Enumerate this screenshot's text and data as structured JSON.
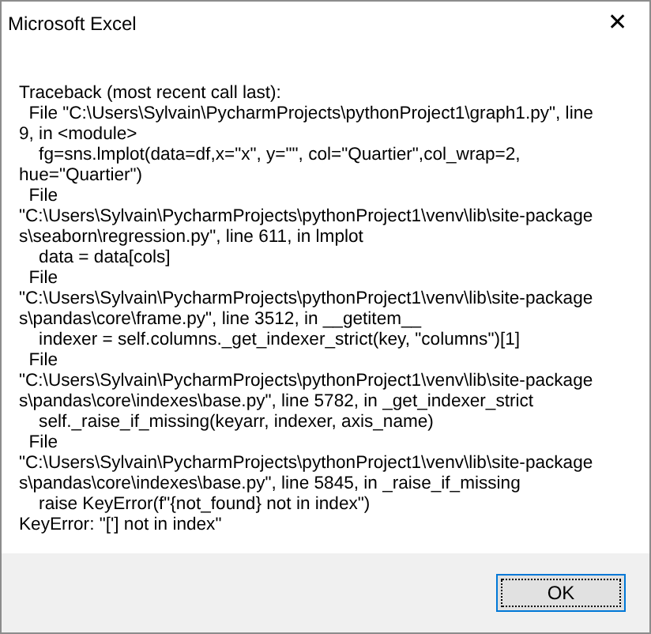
{
  "window": {
    "title": "Microsoft Excel",
    "close": "✕"
  },
  "message_lines": [
    "Traceback (most recent call last):",
    "  File \"C:\\Users\\Sylvain\\PycharmProjects\\pythonProject1\\graph1.py\", line",
    "9, in <module>",
    "    fg=sns.lmplot(data=df,x=\"x\", y=\"\", col=\"Quartier\",col_wrap=2,",
    "hue=\"Quartier\")",
    "  File",
    "\"C:\\Users\\Sylvain\\PycharmProjects\\pythonProject1\\venv\\lib\\site-package",
    "s\\seaborn\\regression.py\", line 611, in lmplot",
    "    data = data[cols]",
    "  File",
    "\"C:\\Users\\Sylvain\\PycharmProjects\\pythonProject1\\venv\\lib\\site-package",
    "s\\pandas\\core\\frame.py\", line 3512, in __getitem__",
    "    indexer = self.columns._get_indexer_strict(key, \"columns\")[1]",
    "  File",
    "\"C:\\Users\\Sylvain\\PycharmProjects\\pythonProject1\\venv\\lib\\site-package",
    "s\\pandas\\core\\indexes\\base.py\", line 5782, in _get_indexer_strict",
    "    self._raise_if_missing(keyarr, indexer, axis_name)",
    "  File",
    "\"C:\\Users\\Sylvain\\PycharmProjects\\pythonProject1\\venv\\lib\\site-package",
    "s\\pandas\\core\\indexes\\base.py\", line 5845, in _raise_if_missing",
    "    raise KeyError(f\"{not_found} not in index\")",
    "KeyError: \"['] not in index\""
  ],
  "buttons": [
    {
      "label": "OK",
      "focused": true
    }
  ]
}
